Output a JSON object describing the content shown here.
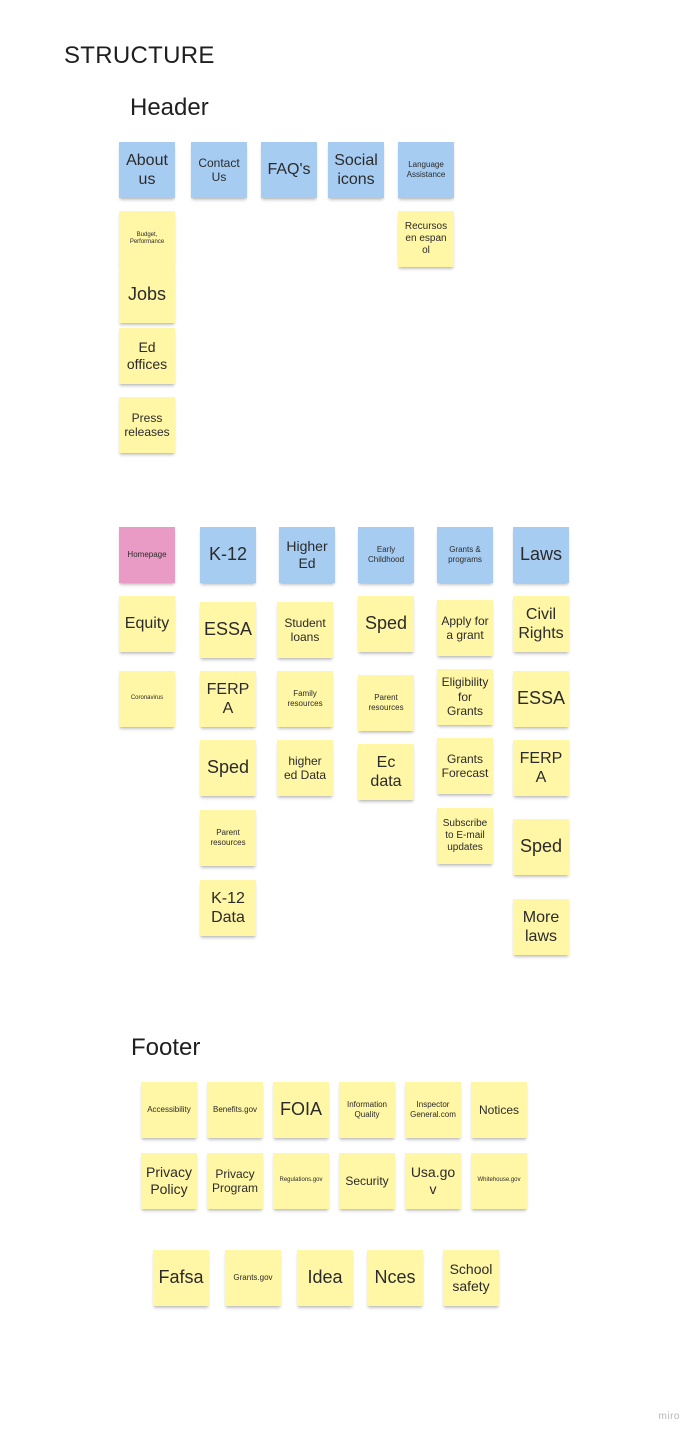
{
  "title": "STRUCTURE",
  "sections": {
    "header_label": "Header",
    "footer_label": "Footer"
  },
  "header": {
    "nav": [
      "About us",
      "Contact Us",
      "FAQ's",
      "Social icons",
      "Language Assistance"
    ],
    "about_children": [
      "Budget, Performance",
      "Jobs",
      "Ed offices",
      "Press releases"
    ],
    "language_children": [
      "Recursos en espan ol"
    ]
  },
  "main": {
    "homepage": {
      "title": "Homepage",
      "items": [
        "Equity",
        "Coronavirus"
      ]
    },
    "k12": {
      "title": "K-12",
      "items": [
        "ESSA",
        "FERPA",
        "Sped",
        "Parent resources",
        "K-12 Data"
      ]
    },
    "higher_ed": {
      "title": "Higher Ed",
      "items": [
        "Student loans",
        "Family resources",
        "higher ed Data"
      ]
    },
    "early_childhood": {
      "title": "Early Childhood",
      "items": [
        "Sped",
        "Parent resources",
        "Ec data"
      ]
    },
    "grants": {
      "title": "Grants & programs",
      "items": [
        "Apply for a grant",
        "Eligibility for Grants",
        "Grants Forecast",
        "Subscribe to E-mail updates"
      ]
    },
    "laws": {
      "title": "Laws",
      "items": [
        "Civil Rights",
        "ESSA",
        "FERPA",
        "Sped",
        "More laws"
      ]
    }
  },
  "footer": {
    "row1": [
      "Accessibility",
      "Benefits.gov",
      "FOIA",
      "Information Quality",
      "Inspector General.com",
      "Notices"
    ],
    "row2": [
      "Privacy Policy",
      "Privacy Program",
      "Regulations.gov",
      "Security",
      "Usa.gov",
      "Whitehouse.gov"
    ],
    "row3": [
      "Fafsa",
      "Grants.gov",
      "Idea",
      "Nces",
      "School safety"
    ]
  },
  "branding": {
    "logo_text": "miro"
  },
  "colors": {
    "sticky_yellow": "#fff6a6",
    "sticky_blue": "#a6ccf2",
    "sticky_pink": "#ea9bc5"
  }
}
